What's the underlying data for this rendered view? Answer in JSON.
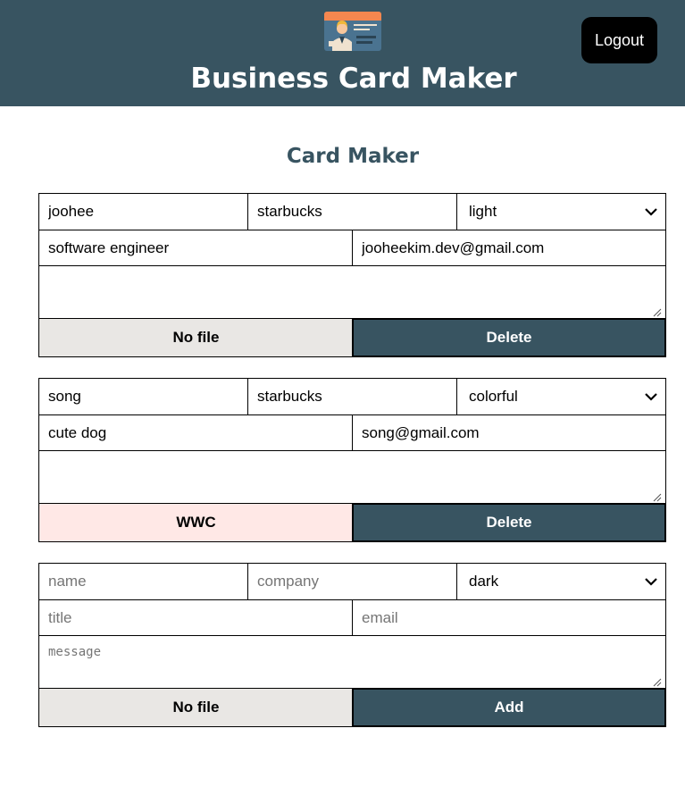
{
  "header": {
    "title": "Business Card Maker",
    "logo_icon": "business-card-icon",
    "logout_label": "Logout",
    "bg_color": "#385461"
  },
  "maker": {
    "title": "Card Maker"
  },
  "cards": [
    {
      "name": "joohee",
      "company": "starbucks",
      "theme": "light",
      "title": "software engineer",
      "email": "jooheekim.dev@gmail.com",
      "message": "",
      "file_label": "No file",
      "file_bg": "#e9e7e4",
      "action_label": "Delete"
    },
    {
      "name": "song",
      "company": "starbucks",
      "theme": "colorful",
      "title": "cute dog",
      "email": "song@gmail.com",
      "message": "",
      "file_label": "WWC",
      "file_bg": "#ffe8e6",
      "action_label": "Delete"
    }
  ],
  "add_form": {
    "placeholders": {
      "name": "name",
      "company": "company",
      "title": "title",
      "email": "email",
      "message": "message"
    },
    "theme": "dark",
    "file_label": "No file",
    "file_bg": "#e9e7e4",
    "action_label": "Add"
  },
  "colors": {
    "accent": "#385461",
    "button_dark": "#000000"
  }
}
